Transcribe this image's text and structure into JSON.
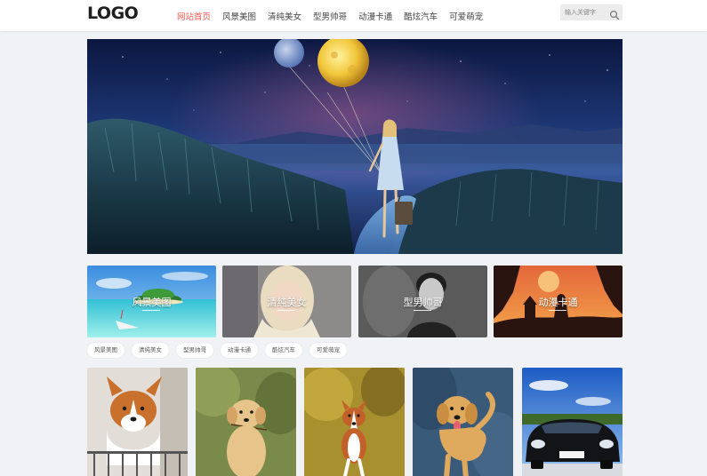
{
  "header": {
    "logo": "LOGO",
    "nav": [
      {
        "label": "网站首页",
        "active": true
      },
      {
        "label": "风景美图",
        "active": false
      },
      {
        "label": "清纯美女",
        "active": false
      },
      {
        "label": "型男帅哥",
        "active": false
      },
      {
        "label": "动漫卡通",
        "active": false
      },
      {
        "label": "酷炫汽车",
        "active": false
      },
      {
        "label": "可爱萌宠",
        "active": false
      }
    ],
    "search": {
      "placeholder": "输入关键字",
      "icon": "search-icon"
    }
  },
  "categories": [
    {
      "label": "风景美图"
    },
    {
      "label": "清纯美女"
    },
    {
      "label": "型男帅哥"
    },
    {
      "label": "动漫卡通"
    }
  ],
  "tags": [
    "风景美图",
    "清纯美女",
    "型男帅哥",
    "动漫卡通",
    "酷炫汽车",
    "可爱萌宠"
  ],
  "thumbnails": [
    {
      "subject": "corgi puppy"
    },
    {
      "subject": "golden retriever puppy"
    },
    {
      "subject": "small dog in field"
    },
    {
      "subject": "golden retriever"
    },
    {
      "subject": "black sports car"
    }
  ],
  "colors": {
    "accent": "#ff5a4e",
    "page_bg": "#f1f2f6"
  }
}
